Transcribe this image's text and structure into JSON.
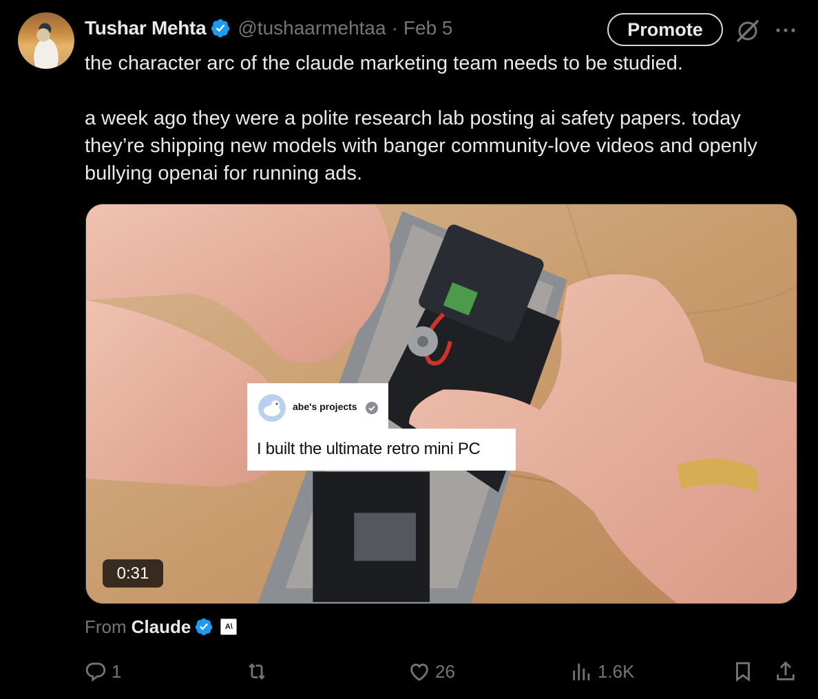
{
  "author": {
    "name": "Tushar Mehta",
    "handle": "@tushaarmehtaa",
    "separator": "·",
    "date": "Feb 5",
    "verified_color": "#1d9bf0"
  },
  "header": {
    "promote_label": "Promote",
    "grok_icon": "grok-icon",
    "more_icon": "more-icon"
  },
  "tweet": {
    "paragraphs": [
      "the character arc of the claude marketing team needs to be studied.",
      "a week ago they were a polite research lab posting ai safety papers. today they’re shipping new models with banger community-love videos and openly bullying openai for running ads."
    ]
  },
  "media": {
    "caption_channel": "abe's projects",
    "caption_text": "I built the ultimate retro mini PC",
    "duration": "0:31"
  },
  "source": {
    "from_label": "From",
    "name": "Claude",
    "badge": "A\\"
  },
  "actions": {
    "reply_count": "1",
    "repost_count": "",
    "like_count": "26",
    "views_count": "1.6K"
  }
}
